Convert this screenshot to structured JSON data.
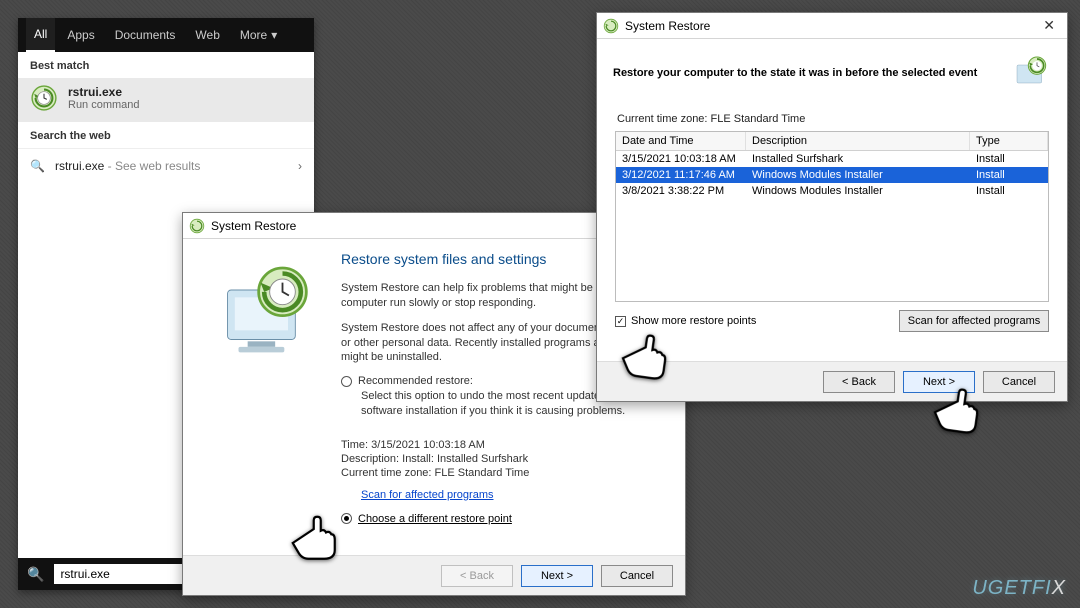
{
  "search": {
    "tabs": [
      "All",
      "Apps",
      "Documents",
      "Web",
      "More"
    ],
    "best_match_label": "Best match",
    "best_title": "rstrui.exe",
    "best_sub": "Run command",
    "web_label": "Search the web",
    "web_item": "rstrui.exe",
    "web_sub": " - See web results",
    "input_value": "rstrui.exe"
  },
  "win1": {
    "title": "System Restore",
    "heading": "Restore system files and settings",
    "p1": "System Restore can help fix problems that might be making your computer run slowly or stop responding.",
    "p2": "System Restore does not affect any of your documents, pictures, or other personal data. Recently installed programs and drivers might be uninstalled.",
    "opt_recommended": "Recommended restore:",
    "opt_rec_desc": "Select this option to undo the most recent update, driver, or software installation if you think it is causing problems.",
    "time": "Time: 3/15/2021 10:03:18 AM",
    "desc": "Description: Install: Installed Surfshark",
    "tz": "Current time zone: FLE Standard Time",
    "scan_link": "Scan for affected programs",
    "opt_choose": "Choose a different restore point",
    "back": "< Back",
    "next": "Next >",
    "cancel": "Cancel"
  },
  "win2": {
    "title": "System Restore",
    "heading": "Restore your computer to the state it was in before the selected event",
    "tz": "Current time zone: FLE Standard Time",
    "cols": {
      "dt": "Date and Time",
      "desc": "Description",
      "type": "Type"
    },
    "rows": [
      {
        "dt": "3/15/2021 10:03:18 AM",
        "desc": "Installed Surfshark",
        "type": "Install",
        "sel": false
      },
      {
        "dt": "3/12/2021 11:17:46 AM",
        "desc": "Windows Modules Installer",
        "type": "Install",
        "sel": true
      },
      {
        "dt": "3/8/2021 3:38:22 PM",
        "desc": "Windows Modules Installer",
        "type": "Install",
        "sel": false
      }
    ],
    "show_more": "Show more restore points",
    "sfap": "Scan for affected programs",
    "back": "< Back",
    "next": "Next >",
    "cancel": "Cancel"
  },
  "watermark": "UGETFIX"
}
